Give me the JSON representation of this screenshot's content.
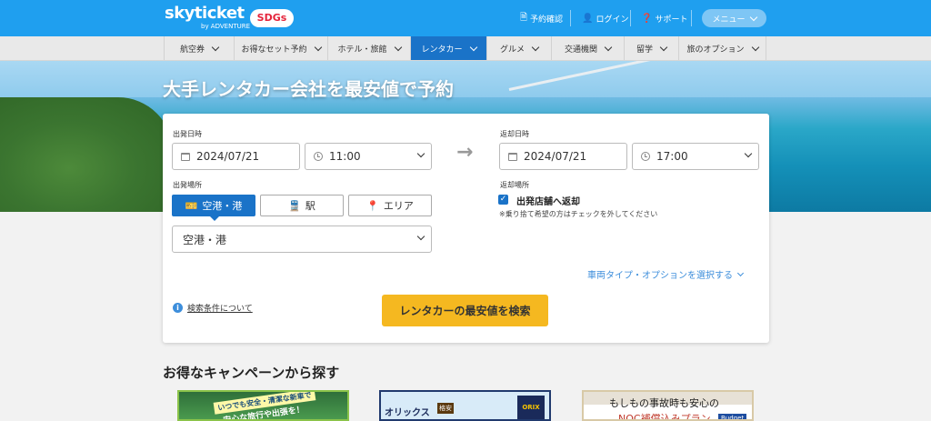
{
  "header": {
    "logo_main": "skyticket",
    "logo_sub": "by ADVENTURE",
    "sdgs": "SDGs",
    "links": [
      {
        "label": "予約確認",
        "icon": "document-icon"
      },
      {
        "label": "ログイン",
        "icon": "user-icon"
      },
      {
        "label": "サポート",
        "icon": "help-icon"
      }
    ],
    "menu_label": "メニュー"
  },
  "nav": {
    "items": [
      {
        "label": "航空券"
      },
      {
        "label": "お得なセット予約"
      },
      {
        "label": "ホテル・旅館"
      },
      {
        "label": "レンタカー",
        "active": true
      },
      {
        "label": "グルメ"
      },
      {
        "label": "交通機関"
      },
      {
        "label": "留学"
      },
      {
        "label": "旅のオプション"
      }
    ]
  },
  "hero": {
    "title": "大手レンタカー会社を最安値で予約"
  },
  "search": {
    "depart_label": "出発日時",
    "depart_date": "2024/07/21",
    "depart_time": "11:00",
    "return_label": "返却日時",
    "return_date": "2024/07/21",
    "return_time": "17:00",
    "depart_place_label": "出発場所",
    "tabs": [
      {
        "label": "空港・港",
        "icon": "ticket-icon",
        "active": true
      },
      {
        "label": "駅",
        "icon": "train-icon"
      },
      {
        "label": "エリア",
        "icon": "pin-icon"
      }
    ],
    "place_select": "空港・港",
    "return_place_label": "返却場所",
    "return_same_label": "出発店舗へ返却",
    "return_same_checked": true,
    "return_note": "※乗り捨て希望の方はチェックを外してください",
    "options_link": "車両タイプ・オプションを選択する",
    "info_link": "検索条件について",
    "search_button": "レンタカーの最安値を検索"
  },
  "campaign": {
    "title": "お得なキャンペーンから探す",
    "banners": [
      {
        "line1": "いつでも安全・清潔な新車で",
        "line2": "安心な旅行や出張を！"
      },
      {
        "line1": "オリックス",
        "badge": "格安",
        "logo": "ORIX"
      },
      {
        "line1": "もしもの事故時も安心の",
        "line2": "NOC補償込みプラン",
        "badge": "Budget"
      }
    ]
  },
  "colors": {
    "header_blue": "#1f9fef",
    "nav_active": "#1a73c8",
    "cta_yellow": "#f5b820",
    "link_blue": "#3d8edb"
  }
}
